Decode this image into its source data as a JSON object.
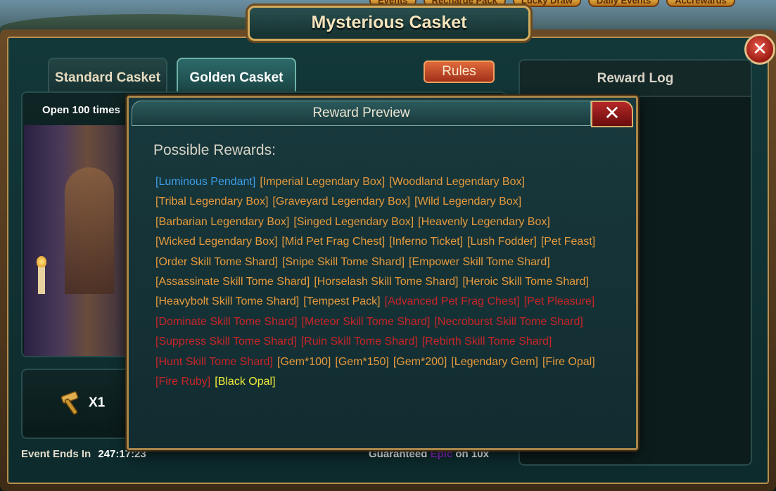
{
  "top_nav": [
    "Events",
    "Recharge Pack",
    "Lucky Draw",
    "Daily Events",
    "Accrewards"
  ],
  "window": {
    "title": "Mysterious Casket",
    "close_glyph": "✕"
  },
  "tabs": [
    {
      "label": "Standard Casket",
      "active": false
    },
    {
      "label": "Golden Casket",
      "active": true
    }
  ],
  "rules_label": "Rules",
  "left_panel": {
    "open_label": "Open 100 times"
  },
  "item": {
    "icon": "hammer-icon",
    "quantity": "X1"
  },
  "event": {
    "label": "Event Ends In",
    "time": "247:17:23"
  },
  "guarantee": {
    "prefix": "Guaranteed",
    "rarity": "Epic",
    "suffix": "on 10x"
  },
  "reward_log": {
    "title": "Reward Log"
  },
  "modal": {
    "title": "Reward Preview",
    "close_glyph": "✕",
    "heading": "Possible Rewards:",
    "rewards": [
      {
        "name": "[Luminous Pendant]",
        "tier": "blue"
      },
      {
        "name": "[Imperial Legendary Box]",
        "tier": "orange"
      },
      {
        "name": "[Woodland Legendary Box]",
        "tier": "orange"
      },
      {
        "name": "[Tribal Legendary Box]",
        "tier": "orange"
      },
      {
        "name": "[Graveyard Legendary Box]",
        "tier": "orange"
      },
      {
        "name": "[Wild Legendary Box]",
        "tier": "orange"
      },
      {
        "name": "[Barbarian Legendary Box]",
        "tier": "orange"
      },
      {
        "name": "[Singed Legendary Box]",
        "tier": "orange"
      },
      {
        "name": "[Heavenly Legendary Box]",
        "tier": "orange"
      },
      {
        "name": "[Wicked Legendary Box]",
        "tier": "orange"
      },
      {
        "name": "[Mid Pet Frag Chest]",
        "tier": "orange"
      },
      {
        "name": "[Inferno Ticket]",
        "tier": "orange"
      },
      {
        "name": "[Lush Fodder]",
        "tier": "orange"
      },
      {
        "name": "[Pet Feast]",
        "tier": "orange"
      },
      {
        "name": "[Order Skill Tome Shard]",
        "tier": "orange"
      },
      {
        "name": "[Snipe Skill Tome Shard]",
        "tier": "orange"
      },
      {
        "name": "[Empower Skill Tome Shard]",
        "tier": "orange"
      },
      {
        "name": "[Assassinate Skill Tome Shard]",
        "tier": "orange"
      },
      {
        "name": "[Horselash Skill Tome Shard]",
        "tier": "orange"
      },
      {
        "name": "[Heroic Skill Tome Shard]",
        "tier": "orange"
      },
      {
        "name": "[Heavybolt Skill Tome Shard]",
        "tier": "orange"
      },
      {
        "name": "[Tempest Pack]",
        "tier": "orange"
      },
      {
        "name": "[Advanced Pet Frag Chest]",
        "tier": "red"
      },
      {
        "name": "[Pet Pleasure]",
        "tier": "red"
      },
      {
        "name": "[Dominate Skill Tome Shard]",
        "tier": "red"
      },
      {
        "name": "[Meteor Skill Tome Shard]",
        "tier": "red"
      },
      {
        "name": "[Necroburst Skill Tome Shard]",
        "tier": "red"
      },
      {
        "name": "[Suppress Skill Tome Shard]",
        "tier": "red"
      },
      {
        "name": "[Ruin Skill Tome Shard]",
        "tier": "red"
      },
      {
        "name": "[Rebirth Skill Tome Shard]",
        "tier": "red"
      },
      {
        "name": "[Hunt Skill Tome Shard]",
        "tier": "red"
      },
      {
        "name": "[Gem*100]",
        "tier": "orange"
      },
      {
        "name": "[Gem*150]",
        "tier": "orange"
      },
      {
        "name": "[Gem*200]",
        "tier": "orange"
      },
      {
        "name": "[Legendary Gem]",
        "tier": "orange"
      },
      {
        "name": "[Fire Opal]",
        "tier": "orange"
      },
      {
        "name": "[Fire Ruby]",
        "tier": "red"
      },
      {
        "name": "[Black Opal]",
        "tier": "yellow"
      }
    ]
  },
  "colors": {
    "blue": "#3c9de8",
    "orange": "#e69a3c",
    "red": "#c82428",
    "yellow": "#f0ec3a",
    "epic": "#8a2ac8"
  }
}
